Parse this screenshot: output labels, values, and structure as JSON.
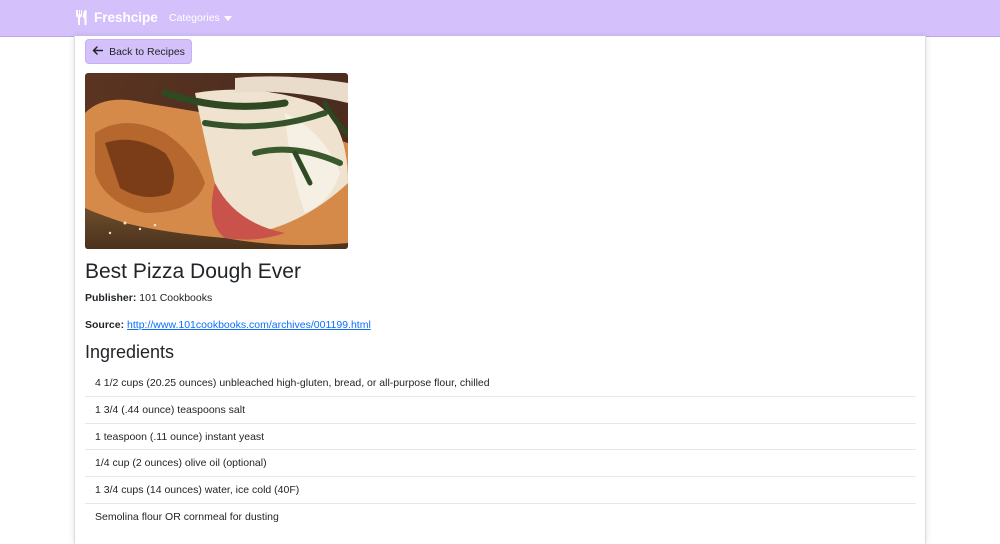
{
  "navbar": {
    "brand": "Freshcipe",
    "brand_icon": "utensils-icon",
    "categories_label": "Categories",
    "color": "#d4c1fb"
  },
  "back_button": {
    "label": "Back to Recipes",
    "icon": "arrow-left-icon"
  },
  "recipe": {
    "title": "Best Pizza Dough Ever",
    "publisher_label": "Publisher:",
    "publisher": "101 Cookbooks",
    "source_label": "Source:",
    "source_url": "http://www.101cookbooks.com/archives/001199.html",
    "image": "pizza-image"
  },
  "ingredients": {
    "heading": "Ingredients",
    "items": [
      "4 1/2 cups (20.25 ounces) unbleached high-gluten, bread, or all-purpose flour, chilled",
      "1 3/4 (.44 ounce) teaspoons salt",
      "1 teaspoon (.11 ounce) instant yeast",
      "1/4 cup (2 ounces) olive oil (optional)",
      "1 3/4 cups (14 ounces) water, ice cold (40F)",
      "Semolina flour OR cornmeal for dusting"
    ]
  }
}
